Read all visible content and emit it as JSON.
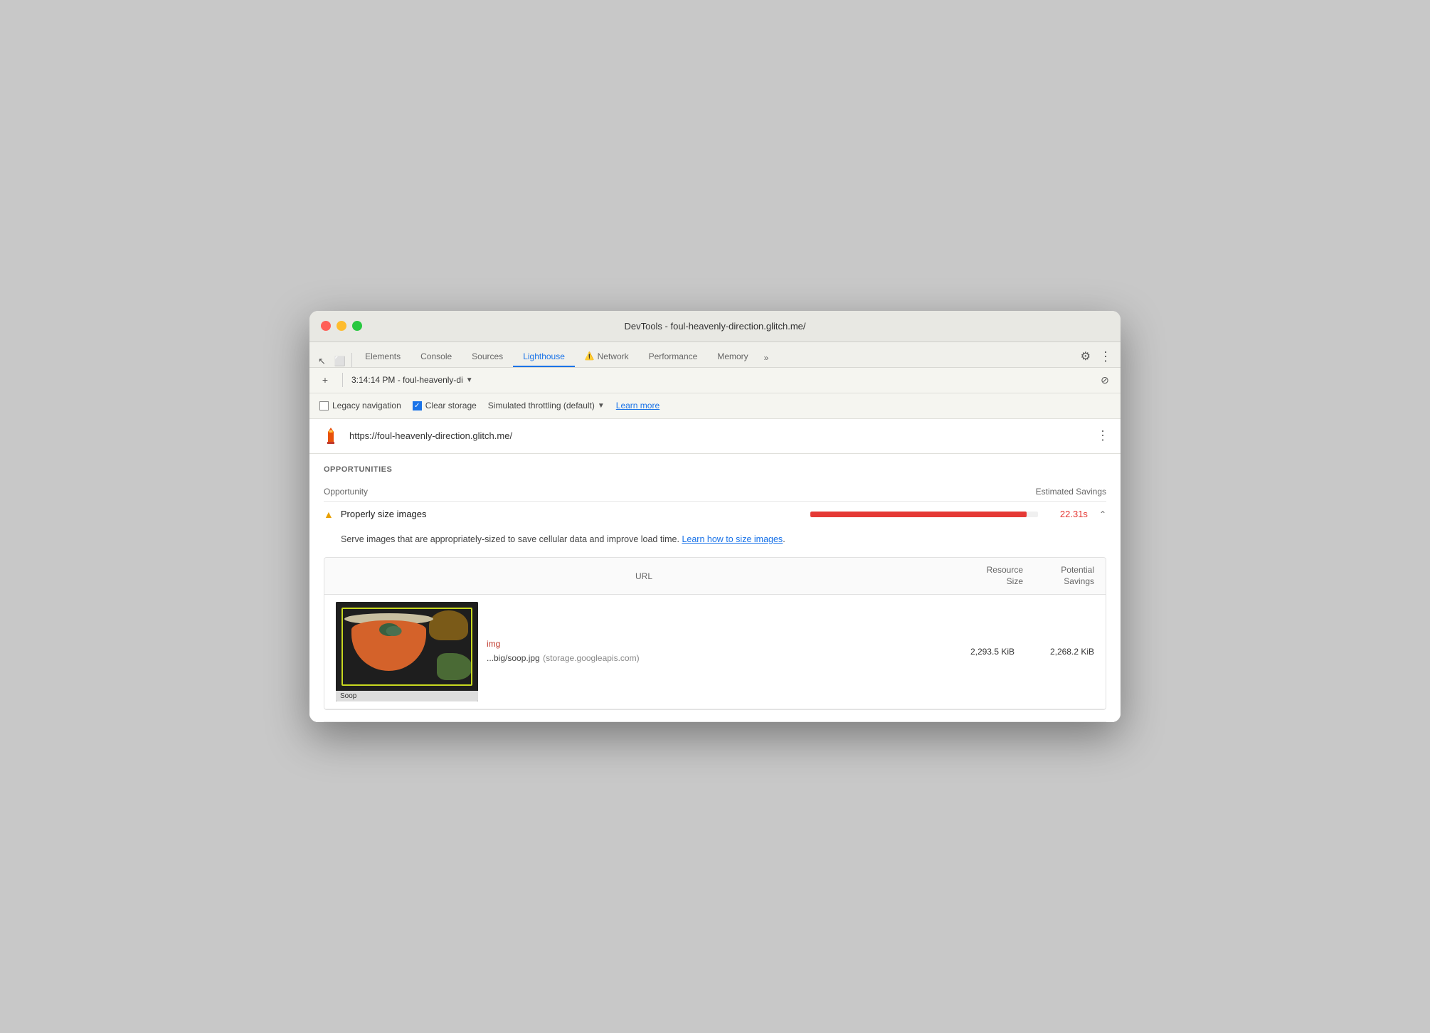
{
  "window": {
    "title": "DevTools - foul-heavenly-direction.glitch.me/"
  },
  "tabs": {
    "items": [
      {
        "label": "Elements",
        "active": false
      },
      {
        "label": "Console",
        "active": false
      },
      {
        "label": "Sources",
        "active": false
      },
      {
        "label": "Lighthouse",
        "active": true
      },
      {
        "label": "Network",
        "active": false,
        "warning": true
      },
      {
        "label": "Performance",
        "active": false
      },
      {
        "label": "Memory",
        "active": false
      }
    ],
    "more": "»"
  },
  "session": {
    "add_label": "+",
    "timestamp": "3:14:14 PM - foul-heavenly-di",
    "block_icon": "⊘"
  },
  "options": {
    "legacy_navigation_label": "Legacy navigation",
    "legacy_navigation_checked": false,
    "clear_storage_label": "Clear storage",
    "clear_storage_checked": true,
    "throttling_label": "Simulated throttling (default)",
    "learn_more_label": "Learn more"
  },
  "site": {
    "url": "https://foul-heavenly-direction.glitch.me/"
  },
  "opportunities": {
    "title": "OPPORTUNITIES",
    "col_opportunity": "Opportunity",
    "col_estimated_savings": "Estimated Savings",
    "items": [
      {
        "title": "Properly size images",
        "severity": "warning",
        "bar_pct": 95,
        "time": "22.31s",
        "description": "Serve images that are appropriately-sized to save cellular data and improve load time.",
        "learn_link": "Learn how to size images",
        "table": {
          "col_url": "URL",
          "col_resource_size": "Resource\nSize",
          "col_potential_savings": "Potential\nSavings",
          "rows": [
            {
              "tag": "img",
              "url_file": "...big/soop.jpg",
              "url_domain": "(storage.googleapis.com)",
              "resource_size": "2,293.5 KiB",
              "potential_savings": "2,268.2 KiB",
              "thumbnail_label": "Soop"
            }
          ]
        }
      }
    ]
  },
  "toolbar": {
    "settings_icon": "⚙",
    "more_icon": "⋮"
  }
}
